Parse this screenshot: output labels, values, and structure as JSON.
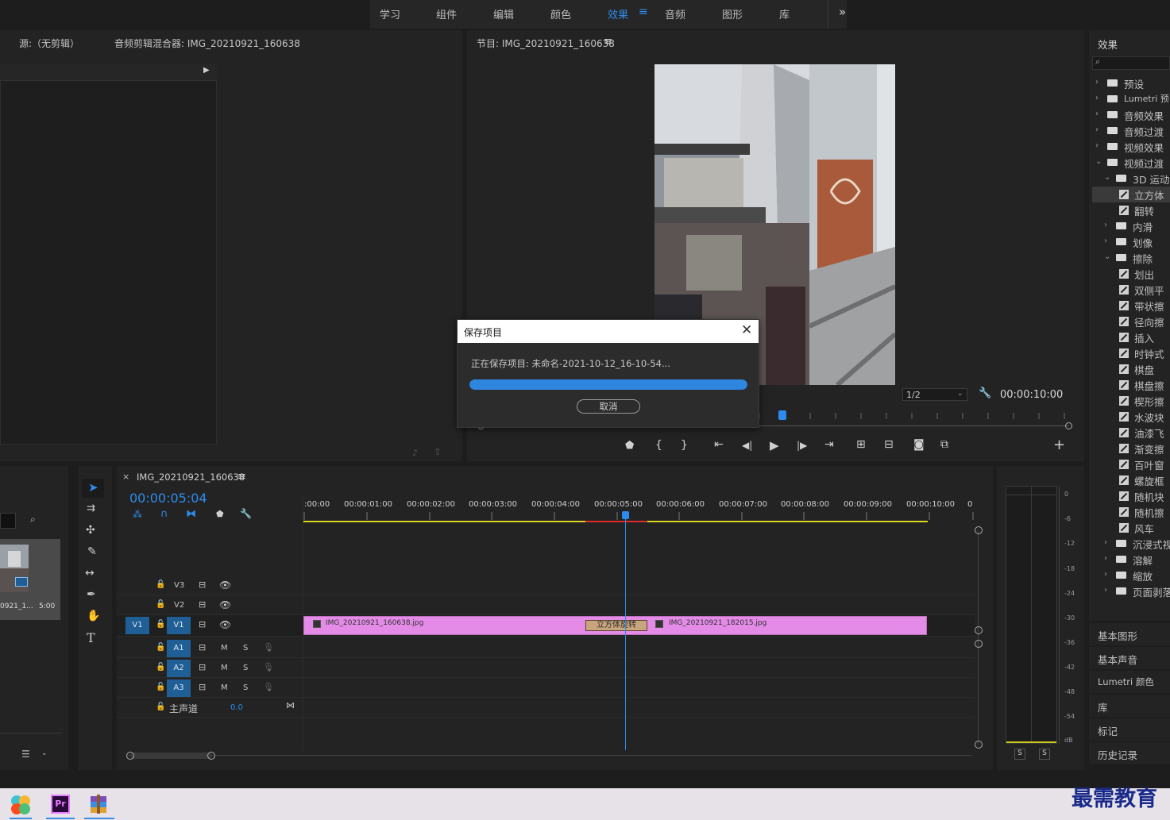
{
  "workspace_tabs": [
    {
      "label": "学习",
      "active": false
    },
    {
      "label": "组件",
      "active": false
    },
    {
      "label": "编辑",
      "active": false
    },
    {
      "label": "颜色",
      "active": false
    },
    {
      "label": "效果",
      "active": true
    },
    {
      "label": "音频",
      "active": false
    },
    {
      "label": "图形",
      "active": false
    },
    {
      "label": "库",
      "active": false
    }
  ],
  "source_panel": {
    "source_title": "源:（无剪辑）",
    "mixer_title": "音频剪辑混合器: IMG_20210921_160638"
  },
  "program_panel": {
    "title": "节目: IMG_20210921_160638",
    "resolution": "1/2",
    "timecode": "00:00:10:00"
  },
  "dialog": {
    "title": "保存项目",
    "message": "正在保存项目: 未命名-2021-10-12_16-10-54...",
    "progress": 1.0,
    "cancel_label": "取消"
  },
  "timeline": {
    "tab_title": "IMG_20210921_160638",
    "timecode": "00:00:05:04",
    "ruler": [
      ":00:00",
      "00:00:01:00",
      "00:00:02:00",
      "00:00:03:00",
      "00:00:04:00",
      "00:00:05:00",
      "00:00:06:00",
      "00:00:07:00",
      "00:00:08:00",
      "00:00:09:00",
      "00:00:10:00",
      "0"
    ],
    "video_tracks": [
      "V3",
      "V2",
      "V1"
    ],
    "source_patch": "V1",
    "audio_tracks": [
      "A1",
      "A2",
      "A3"
    ],
    "mute_label": "M",
    "solo_label": "S",
    "master_label": "主声道",
    "master_value": "0.0",
    "clip1": "IMG_20210921_160638.jpg",
    "clip2": "IMG_20210921_182015.jpg",
    "transition": "立方体旋转"
  },
  "project_thumb": {
    "name": "0921_1...",
    "duration": "5:00"
  },
  "effects_panel": {
    "title": "效果",
    "items": [
      {
        "label": "预设",
        "level": 0,
        "kind": "folder-star",
        "open": false
      },
      {
        "label": "Lumetri 预",
        "level": 0,
        "kind": "folder-star",
        "open": false
      },
      {
        "label": "音频效果",
        "level": 0,
        "kind": "folder",
        "open": false
      },
      {
        "label": "音频过渡",
        "level": 0,
        "kind": "folder",
        "open": false
      },
      {
        "label": "视频效果",
        "level": 0,
        "kind": "folder",
        "open": false
      },
      {
        "label": "视频过渡",
        "level": 0,
        "kind": "folder",
        "open": true
      },
      {
        "label": "3D 运动",
        "level": 1,
        "kind": "folder",
        "open": true
      },
      {
        "label": "立方体",
        "level": 2,
        "kind": "fx",
        "selected": true
      },
      {
        "label": "翻转",
        "level": 2,
        "kind": "fx"
      },
      {
        "label": "内滑",
        "level": 1,
        "kind": "folder",
        "open": false
      },
      {
        "label": "划像",
        "level": 1,
        "kind": "folder",
        "open": false
      },
      {
        "label": "擦除",
        "level": 1,
        "kind": "folder",
        "open": true
      },
      {
        "label": "划出",
        "level": 2,
        "kind": "fx"
      },
      {
        "label": "双侧平",
        "level": 2,
        "kind": "fx"
      },
      {
        "label": "带状擦",
        "level": 2,
        "kind": "fx"
      },
      {
        "label": "径向擦",
        "level": 2,
        "kind": "fx"
      },
      {
        "label": "插入",
        "level": 2,
        "kind": "fx"
      },
      {
        "label": "时钟式",
        "level": 2,
        "kind": "fx"
      },
      {
        "label": "棋盘",
        "level": 2,
        "kind": "fx"
      },
      {
        "label": "棋盘擦",
        "level": 2,
        "kind": "fx"
      },
      {
        "label": "楔形擦",
        "level": 2,
        "kind": "fx"
      },
      {
        "label": "水波块",
        "level": 2,
        "kind": "fx"
      },
      {
        "label": "油漆飞",
        "level": 2,
        "kind": "fx"
      },
      {
        "label": "渐变擦",
        "level": 2,
        "kind": "fx"
      },
      {
        "label": "百叶窗",
        "level": 2,
        "kind": "fx"
      },
      {
        "label": "螺旋框",
        "level": 2,
        "kind": "fx"
      },
      {
        "label": "随机块",
        "level": 2,
        "kind": "fx"
      },
      {
        "label": "随机擦",
        "level": 2,
        "kind": "fx"
      },
      {
        "label": "风车",
        "level": 2,
        "kind": "fx"
      },
      {
        "label": "沉浸式视",
        "level": 1,
        "kind": "folder",
        "open": false
      },
      {
        "label": "溶解",
        "level": 1,
        "kind": "folder",
        "open": false
      },
      {
        "label": "缩放",
        "level": 1,
        "kind": "folder",
        "open": false
      },
      {
        "label": "页面剥落",
        "level": 1,
        "kind": "folder",
        "open": false
      }
    ]
  },
  "side_panels": [
    "基本图形",
    "基本声音",
    "Lumetri 颜色",
    "库",
    "标记",
    "历史记录"
  ],
  "meter": {
    "labels": [
      "0",
      "-6",
      "-12",
      "-18",
      "-24",
      "-30",
      "-36",
      "-42",
      "-48",
      "-54",
      "dB"
    ],
    "solo_left": "S",
    "solo_right": "S"
  },
  "taskbar": {
    "apps": [
      "photos-app",
      "premiere-pro",
      "winrar"
    ],
    "premiere_label": "Pr"
  },
  "watermark": "最需教育",
  "colors": {
    "accent": "#2d8ceb",
    "clip": "#e38be6",
    "dialog_bar": "#2f86de",
    "track_blue": "#1f5f95"
  }
}
